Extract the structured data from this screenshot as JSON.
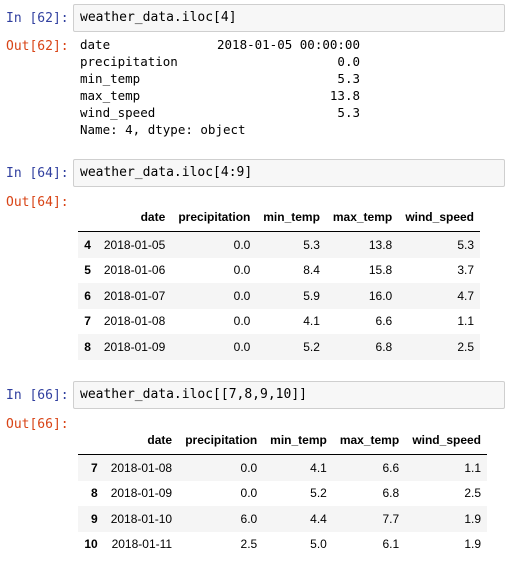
{
  "cells": [
    {
      "in_prompt": "In [62]:",
      "code": "weather_data.iloc[4]",
      "out_prompt": "Out[62]:",
      "series": [
        {
          "key": "date",
          "value": "2018-01-05 00:00:00"
        },
        {
          "key": "precipitation",
          "value": "0.0"
        },
        {
          "key": "min_temp",
          "value": "5.3"
        },
        {
          "key": "max_temp",
          "value": "13.8"
        },
        {
          "key": "wind_speed",
          "value": "5.3"
        }
      ],
      "footer": "Name: 4, dtype: object"
    },
    {
      "in_prompt": "In [64]:",
      "code": "weather_data.iloc[4:9]",
      "out_prompt": "Out[64]:",
      "columns": [
        "",
        "date",
        "precipitation",
        "min_temp",
        "max_temp",
        "wind_speed"
      ],
      "rows": [
        [
          "4",
          "2018-01-05",
          "0.0",
          "5.3",
          "13.8",
          "5.3"
        ],
        [
          "5",
          "2018-01-06",
          "0.0",
          "8.4",
          "15.8",
          "3.7"
        ],
        [
          "6",
          "2018-01-07",
          "0.0",
          "5.9",
          "16.0",
          "4.7"
        ],
        [
          "7",
          "2018-01-08",
          "0.0",
          "4.1",
          "6.6",
          "1.1"
        ],
        [
          "8",
          "2018-01-09",
          "0.0",
          "5.2",
          "6.8",
          "2.5"
        ]
      ]
    },
    {
      "in_prompt": "In [66]:",
      "code": "weather_data.iloc[[7,8,9,10]]",
      "out_prompt": "Out[66]:",
      "columns": [
        "",
        "date",
        "precipitation",
        "min_temp",
        "max_temp",
        "wind_speed"
      ],
      "rows": [
        [
          "7",
          "2018-01-08",
          "0.0",
          "4.1",
          "6.6",
          "1.1"
        ],
        [
          "8",
          "2018-01-09",
          "0.0",
          "5.2",
          "6.8",
          "2.5"
        ],
        [
          "9",
          "2018-01-10",
          "6.0",
          "4.4",
          "7.7",
          "1.9"
        ],
        [
          "10",
          "2018-01-11",
          "2.5",
          "5.0",
          "6.1",
          "1.9"
        ]
      ]
    }
  ]
}
